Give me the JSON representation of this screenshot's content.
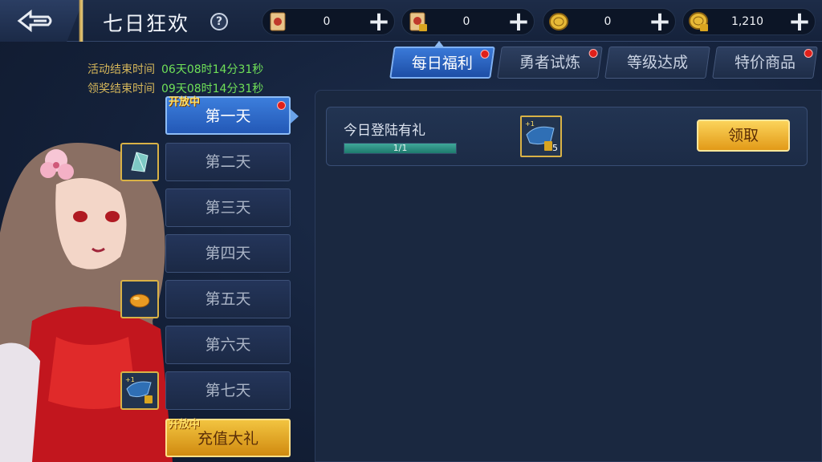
{
  "header": {
    "title": "七日狂欢",
    "help": "?"
  },
  "currencies": [
    {
      "icon": "scroll-icon",
      "value": "0"
    },
    {
      "icon": "locked-scroll-icon",
      "value": "0"
    },
    {
      "icon": "gold-coin-icon",
      "value": "0"
    },
    {
      "icon": "locked-gold-coin-icon",
      "value": "1,210"
    }
  ],
  "timers": {
    "event_end_label": "活动结束时间",
    "event_end_value": "06天08时14分31秒",
    "claim_end_label": "领奖结束时间",
    "claim_end_value": "09天08时14分31秒"
  },
  "tabs": [
    {
      "label": "每日福利",
      "active": true,
      "badge": true
    },
    {
      "label": "勇者试炼",
      "active": false,
      "badge": true
    },
    {
      "label": "等级达成",
      "active": false,
      "badge": false
    },
    {
      "label": "特价商品",
      "active": false,
      "badge": true
    }
  ],
  "days": [
    {
      "label": "第一天",
      "tag": "开放中",
      "active": true,
      "badge": true
    },
    {
      "label": "第二天",
      "icon": "crystal-icon"
    },
    {
      "label": "第三天"
    },
    {
      "label": "第四天"
    },
    {
      "label": "第五天",
      "icon": "ore-icon"
    },
    {
      "label": "第六天"
    },
    {
      "label": "第七天",
      "icon": "locked-wing-icon",
      "icon_tag": "+1"
    },
    {
      "label": "充值大礼",
      "tag": "开放中",
      "gold": true
    }
  ],
  "task": {
    "title": "今日登陆有礼",
    "progress_text": "1/1",
    "progress_fraction": 1.0,
    "reward_tag": "+1",
    "reward_count": "5",
    "claim_label": "领取"
  },
  "colors": {
    "accent_blue": "#3a79d8",
    "gold": "#e29a18",
    "timer_label": "#d5b65a",
    "timer_value": "#6fe058",
    "badge_red": "#e0201a"
  }
}
